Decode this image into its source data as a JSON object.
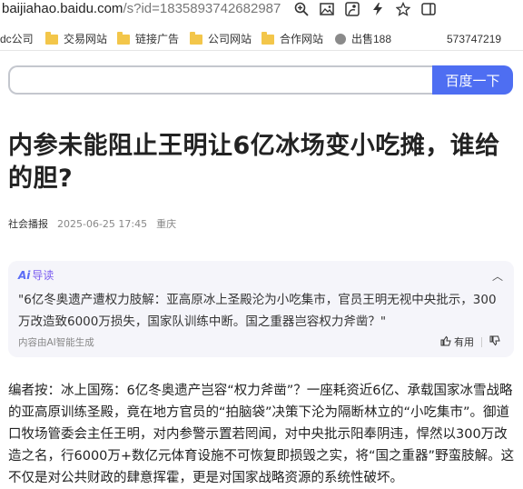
{
  "browser": {
    "url_host": "baijiahao.baidu.com",
    "url_path": "/s?id=1835893742682987",
    "toolbar_icons": [
      "zoom-icon",
      "image-icon",
      "share-icon",
      "lightning-icon",
      "star-icon",
      "tab-icon"
    ]
  },
  "bookmarks": {
    "items": [
      {
        "label": "dc公司",
        "icon": "none"
      },
      {
        "label": "交易网站",
        "icon": "folder-icon"
      },
      {
        "label": "链接广告",
        "icon": "folder-icon"
      },
      {
        "label": "公司网站",
        "icon": "folder-icon"
      },
      {
        "label": "合作网站",
        "icon": "folder-icon"
      },
      {
        "label": "出售188",
        "icon": "globe-icon"
      }
    ],
    "trailing": "573747219"
  },
  "search": {
    "value": "",
    "button_label": "百度一下"
  },
  "article": {
    "title": "内参未能阻止王明让6亿冰场变小吃摊，谁给的胆?",
    "source": "社会播报",
    "date": "2025-06-25 17:45",
    "location": "重庆",
    "ai_summary": {
      "label": "导读",
      "badge": "Ai",
      "text": "\"6亿冬奥遗产遭权力肢解：亚高原冰上圣殿沦为小吃集市，官员王明无视中央批示，300万改造致6000万损失，国家队训练中断。国之重器岂容权力斧凿？\"",
      "source_note": "内容由AI智能生成",
      "useful_label": "有用"
    },
    "body": "编者按：冰上国殇：6亿冬奥遗产岂容“权力斧凿”？一座耗资近6亿、承载国家冰雪战略的亚高原训练圣殿，竟在地方官员的“拍脑袋”决策下沦为隔断林立的“小吃集市”。御道口牧场管委会主任王明，对内参警示置若罔闻，对中央批示阳奉阴违，悍然以300万改造之名，行6000万+数亿元体育设施不可恢复即损毁之实，将“国之重器”野蛮肢解。这不仅是对公共财政的肆意挥霍，更是对国家战略资源的系统性破坏。"
  },
  "colors": {
    "accent": "#4e6ef2",
    "ai_purple": "#7a5cf0",
    "card_bg": "#f5f5fa"
  }
}
